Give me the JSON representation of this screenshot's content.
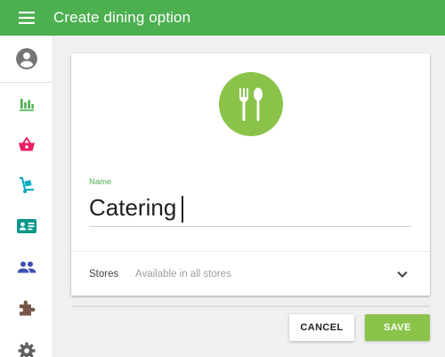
{
  "header": {
    "title": "Create dining option",
    "menu_icon": "hamburger-menu-icon",
    "background": "#4caf50"
  },
  "sidebar": {
    "items": [
      {
        "name": "account",
        "icon": "account-circle-icon",
        "color": "#757575"
      },
      {
        "name": "reports",
        "icon": "bar-chart-icon",
        "color": "#4caf50"
      },
      {
        "name": "items",
        "icon": "basket-icon",
        "color": "#e91e63"
      },
      {
        "name": "inventory",
        "icon": "hand-truck-icon",
        "color": "#00acc1"
      },
      {
        "name": "customers",
        "icon": "id-card-icon",
        "color": "#009688"
      },
      {
        "name": "employees",
        "icon": "people-icon",
        "color": "#3f51b5"
      },
      {
        "name": "integrations",
        "icon": "puzzle-piece-icon",
        "color": "#795548"
      },
      {
        "name": "settings",
        "icon": "gear-icon",
        "color": "#616161"
      }
    ]
  },
  "form": {
    "hero_icon": "fork-spoon-icon",
    "hero_color": "#8bc34a",
    "name_label": "Name",
    "name_value": "Catering",
    "stores_label": "Stores",
    "stores_value": "Available in all stores",
    "stores_icon": "chevron-down-icon"
  },
  "actions": {
    "cancel_label": "CANCEL",
    "save_label": "SAVE"
  }
}
